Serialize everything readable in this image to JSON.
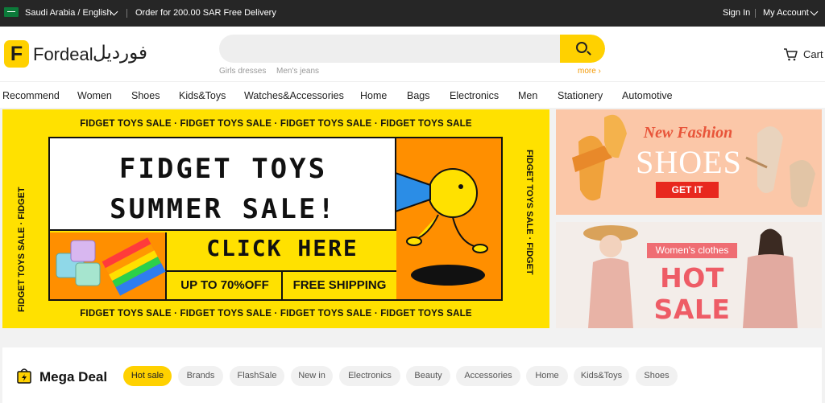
{
  "topbar": {
    "region": "Saudi Arabia / English",
    "promo": "Order for 200.00 SAR Free Delivery",
    "sign_in": "Sign In",
    "separator": "|",
    "account": "My Account"
  },
  "header": {
    "logo_letter": "F",
    "logo_text": "Fordeal",
    "logo_arabic": "فورديل",
    "search_placeholder": "",
    "hot_words": [
      "Girls dresses",
      "Men's jeans"
    ],
    "more": "more ›",
    "cart": "Cart"
  },
  "nav": [
    "Recommend",
    "Women",
    "Shoes",
    "Kids&Toys",
    "Watches&Accessories",
    "Home",
    "Bags",
    "Electronics",
    "Men",
    "Stationery",
    "Automotive"
  ],
  "main_banner": {
    "strip": "FIDGET TOYS SALE · FIDGET TOYS SALE · FIDGET TOYS SALE · FIDGET TOYS SALE",
    "side": "FIDGET TOYS SALE · FIDGET",
    "title_line1": "FIDGET TOYS",
    "title_line2": "SUMMER SALE!",
    "cta": "CLICK HERE",
    "discount": "UP TO 70%OFF",
    "shipping": "FREE SHIPPING"
  },
  "shoes_banner": {
    "tagline": "New Fashion",
    "headline": "SHOES",
    "button": "GET IT"
  },
  "women_banner": {
    "tag": "Women's clothes",
    "headline": "HOT SALE"
  },
  "mega_deal": {
    "title": "Mega Deal",
    "chips": [
      "Hot sale",
      "Brands",
      "FlashSale",
      "New in",
      "Electronics",
      "Beauty",
      "Accessories",
      "Home",
      "Kids&Toys",
      "Shoes"
    ],
    "active_chip": "Hot sale"
  },
  "colors": {
    "brand_yellow": "#ffd100",
    "topbar_bg": "#262626",
    "accent_orange": "#f39800"
  }
}
